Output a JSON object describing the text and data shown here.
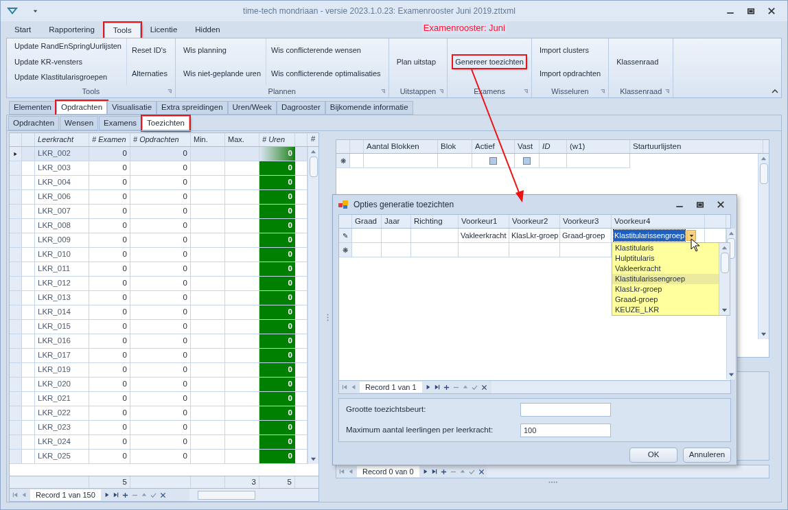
{
  "window": {
    "title": "time-tech mondriaan - versie 2023.1.0.23: Examenrooster Juni 2019.zttxml"
  },
  "ribbon_tabs": [
    {
      "label": "Start",
      "selected": false,
      "annotated": false
    },
    {
      "label": "Rapportering",
      "selected": false,
      "annotated": false
    },
    {
      "label": "Tools",
      "selected": true,
      "annotated": true
    },
    {
      "label": "Licentie",
      "selected": false,
      "annotated": false
    },
    {
      "label": "Hidden",
      "selected": false,
      "annotated": false
    }
  ],
  "document_label": "Examenrooster: Juni",
  "ribbon_groups": [
    {
      "label": "Tools",
      "columns": [
        [
          {
            "label": "Update RandEnSpringUurlijsten",
            "annotated": false
          },
          {
            "label": "Update KR-vensters",
            "annotated": false
          },
          {
            "label": "Update Klastitularisgroepen",
            "annotated": false
          }
        ],
        [
          {
            "label": "Reset ID's",
            "annotated": false
          },
          {
            "label": "Alternaties",
            "annotated": false
          }
        ]
      ]
    },
    {
      "label": "Plannen",
      "columns": [
        [
          {
            "label": "Wis planning",
            "annotated": false
          },
          {
            "label": "Wis niet-geplande uren",
            "annotated": false
          }
        ],
        [
          {
            "label": "Wis conflicterende wensen",
            "annotated": false
          },
          {
            "label": "Wis conflicterende optimalisaties",
            "annotated": false
          }
        ]
      ]
    },
    {
      "label": "Uitstappen",
      "columns": [
        [
          {
            "label": "Plan uitstap",
            "annotated": false
          }
        ]
      ]
    },
    {
      "label": "Examens",
      "columns": [
        [
          {
            "label": "Genereer toezichten",
            "annotated": true
          }
        ]
      ]
    },
    {
      "label": "Wisseluren",
      "columns": [
        [
          {
            "label": "Import clusters",
            "annotated": false
          },
          {
            "label": "Import opdrachten",
            "annotated": false
          }
        ]
      ]
    },
    {
      "label": "Klassenraad",
      "columns": [
        [
          {
            "label": "Klassenraad",
            "annotated": false
          }
        ]
      ]
    }
  ],
  "main_tabs": [
    {
      "label": "Elementen",
      "selected": false,
      "annotated": false
    },
    {
      "label": "Opdrachten",
      "selected": true,
      "annotated": true
    },
    {
      "label": "Visualisatie",
      "selected": false,
      "annotated": false
    },
    {
      "label": "Extra spreidingen",
      "selected": false,
      "annotated": false
    },
    {
      "label": "Uren/Week",
      "selected": false,
      "annotated": false
    },
    {
      "label": "Dagrooster",
      "selected": false,
      "annotated": false
    },
    {
      "label": "Bijkomende informatie",
      "selected": false,
      "annotated": false
    }
  ],
  "sub_tabs": [
    {
      "label": "Opdrachten",
      "selected": false,
      "annotated": false
    },
    {
      "label": "Wensen",
      "selected": false,
      "annotated": false
    },
    {
      "label": "Examens",
      "selected": false,
      "annotated": false
    },
    {
      "label": "Toezichten",
      "selected": true,
      "annotated": true
    }
  ],
  "teacher_grid": {
    "columns": [
      "Leerkracht",
      "# Examen",
      "# Opdrachten",
      "Min.",
      "Max.",
      "# Uren",
      "#"
    ],
    "rows": [
      {
        "teacher": "LKR_002",
        "examen": "0",
        "opdrachten": "0",
        "uren": "0",
        "selected": true
      },
      {
        "teacher": "LKR_003",
        "examen": "0",
        "opdrachten": "0",
        "uren": "0",
        "selected": false
      },
      {
        "teacher": "LKR_004",
        "examen": "0",
        "opdrachten": "0",
        "uren": "0",
        "selected": false
      },
      {
        "teacher": "LKR_006",
        "examen": "0",
        "opdrachten": "0",
        "uren": "0",
        "selected": false
      },
      {
        "teacher": "LKR_007",
        "examen": "0",
        "opdrachten": "0",
        "uren": "0",
        "selected": false
      },
      {
        "teacher": "LKR_008",
        "examen": "0",
        "opdrachten": "0",
        "uren": "0",
        "selected": false
      },
      {
        "teacher": "LKR_009",
        "examen": "0",
        "opdrachten": "0",
        "uren": "0",
        "selected": false
      },
      {
        "teacher": "LKR_010",
        "examen": "0",
        "opdrachten": "0",
        "uren": "0",
        "selected": false
      },
      {
        "teacher": "LKR_011",
        "examen": "0",
        "opdrachten": "0",
        "uren": "0",
        "selected": false
      },
      {
        "teacher": "LKR_012",
        "examen": "0",
        "opdrachten": "0",
        "uren": "0",
        "selected": false
      },
      {
        "teacher": "LKR_013",
        "examen": "0",
        "opdrachten": "0",
        "uren": "0",
        "selected": false
      },
      {
        "teacher": "LKR_014",
        "examen": "0",
        "opdrachten": "0",
        "uren": "0",
        "selected": false
      },
      {
        "teacher": "LKR_015",
        "examen": "0",
        "opdrachten": "0",
        "uren": "0",
        "selected": false
      },
      {
        "teacher": "LKR_016",
        "examen": "0",
        "opdrachten": "0",
        "uren": "0",
        "selected": false
      },
      {
        "teacher": "LKR_017",
        "examen": "0",
        "opdrachten": "0",
        "uren": "0",
        "selected": false
      },
      {
        "teacher": "LKR_019",
        "examen": "0",
        "opdrachten": "0",
        "uren": "0",
        "selected": false
      },
      {
        "teacher": "LKR_020",
        "examen": "0",
        "opdrachten": "0",
        "uren": "0",
        "selected": false
      },
      {
        "teacher": "LKR_021",
        "examen": "0",
        "opdrachten": "0",
        "uren": "0",
        "selected": false
      },
      {
        "teacher": "LKR_022",
        "examen": "0",
        "opdrachten": "0",
        "uren": "0",
        "selected": false
      },
      {
        "teacher": "LKR_023",
        "examen": "0",
        "opdrachten": "0",
        "uren": "0",
        "selected": false
      },
      {
        "teacher": "LKR_024",
        "examen": "0",
        "opdrachten": "0",
        "uren": "0",
        "selected": false
      },
      {
        "teacher": "LKR_025",
        "examen": "0",
        "opdrachten": "0",
        "uren": "0",
        "selected": false
      }
    ],
    "totals": {
      "examen": "5",
      "max": "3",
      "uren": "5"
    },
    "navigator": "Record 1 van 150"
  },
  "block_grid": {
    "columns": [
      "Aantal Blokken",
      "Blok",
      "Actief",
      "Vast",
      "ID",
      "(w1)",
      "Startuurlijsten"
    ],
    "new_row": {
      "marker": "❋",
      "actief": false,
      "vast": false
    },
    "navigator": "Record 0 van 0"
  },
  "dialog": {
    "title": "Opties generatie toezichten",
    "columns": [
      "Graad",
      "Jaar",
      "Richting",
      "Voorkeur1",
      "Voorkeur2",
      "Voorkeur3",
      "Voorkeur4"
    ],
    "rows": [
      {
        "marker": "✎",
        "cells": [
          "",
          "",
          "",
          "Vakleerkracht",
          "KlasLkr-groep",
          "Graad-groep",
          "Klastitularissengroep"
        ]
      }
    ],
    "new_row_marker": "❋",
    "dropdown": [
      {
        "label": "Klastitularis",
        "selected": false
      },
      {
        "label": "Hulptitularis",
        "selected": false
      },
      {
        "label": "Vakleerkracht",
        "selected": false
      },
      {
        "label": "Klastitularissengroep",
        "selected": true
      },
      {
        "label": "KlasLkr-groep",
        "selected": false
      },
      {
        "label": "Graad-groep",
        "selected": false
      },
      {
        "label": "KEUZE_LKR",
        "selected": false
      }
    ],
    "navigator": "Record 1 van 1",
    "fields": [
      {
        "label": "Grootte toezichtsbeurt:"
      },
      {
        "label": "Maximum aantal leerlingen per leerkracht:",
        "value": "100"
      }
    ],
    "buttons": [
      "OK",
      "Annuleren"
    ]
  }
}
